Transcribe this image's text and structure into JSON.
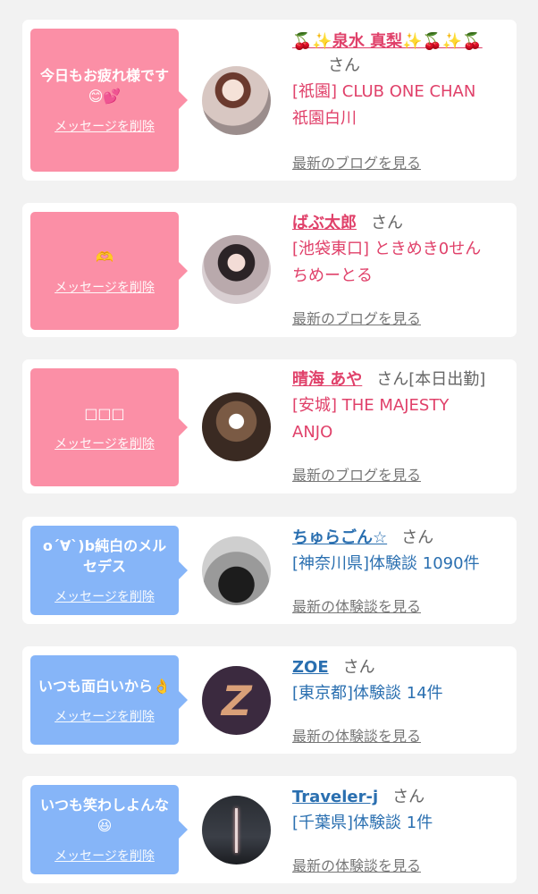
{
  "cards": [
    {
      "message": "今日もお疲れ様です😊💕",
      "delete_label": "メッセージを削除",
      "name": "🍒✨泉水 真梨✨🍒✨🍒",
      "honorific": "さん",
      "status": "",
      "lines": [
        "[祇園] CLUB ONE CHAN",
        "祇園白川"
      ],
      "link": "最新のブログを見る"
    },
    {
      "message": "🫶",
      "delete_label": "メッセージを削除",
      "name": "ばぶ太郎",
      "honorific": "さん",
      "status": "",
      "lines": [
        "[池袋東口] ときめき0せん",
        "ちめーとる"
      ],
      "link": "最新のブログを見る"
    },
    {
      "message": "□□□",
      "delete_label": "メッセージを削除",
      "name": "晴海 あや",
      "honorific": "さん",
      "status": "[本日出勤]",
      "lines": [
        "[安城] THE MAJESTY",
        "ANJO"
      ],
      "link": "最新のブログを見る"
    },
    {
      "message": "o´∀`)b純白のメルセデス",
      "delete_label": "メッセージを削除",
      "name": "ちゅらごん☆",
      "honorific": "さん",
      "status": "",
      "lines": [
        "[神奈川県]体験談 1090件"
      ],
      "link": "最新の体験談を見る"
    },
    {
      "message": "いつも面白いから👌",
      "delete_label": "メッセージを削除",
      "name": "ZOE",
      "honorific": "さん",
      "status": "",
      "lines": [
        "[東京都]体験談 14件"
      ],
      "link": "最新の体験談を見る"
    },
    {
      "message": "いつも笑わしよんな😆",
      "delete_label": "メッセージを削除",
      "name": "Traveler-j",
      "honorific": "さん",
      "status": "",
      "lines": [
        "[千葉県]体験談 1件"
      ],
      "link": "最新の体験談を見る"
    }
  ],
  "avatar_icons": [
    "photo-avatar-icon",
    "photo-avatar-icon",
    "photo-avatar-icon",
    "photo-avatar-icon",
    "z-logo-avatar-icon",
    "night-tower-avatar-icon"
  ],
  "colors": {
    "pink_bubble": "#fb8fa6",
    "blue_bubble": "#86b5f8",
    "pink_text": "#e0416a",
    "blue_text": "#2a6fb0"
  }
}
